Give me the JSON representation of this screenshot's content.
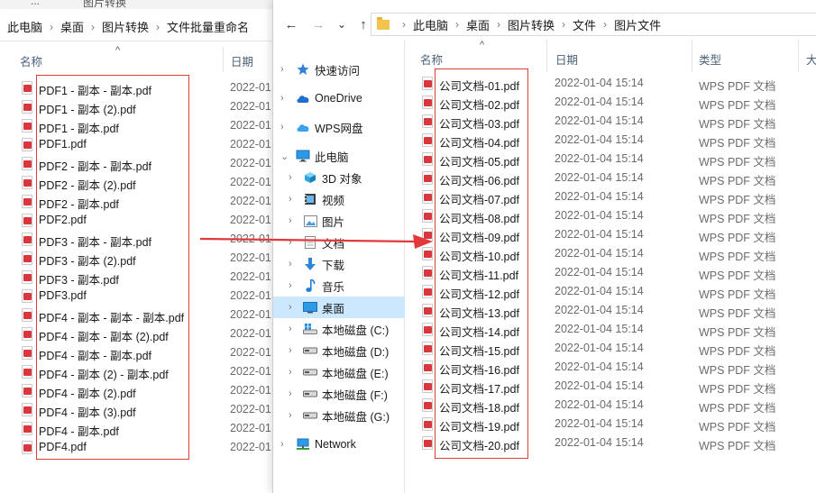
{
  "left_window": {
    "top_stubs": [
      "...",
      "图片转换"
    ],
    "breadcrumb": [
      "此电脑",
      "桌面",
      "图片转换",
      "文件批量重命名"
    ],
    "columns": {
      "name": "名称",
      "date": "日期"
    },
    "files": [
      {
        "name": "PDF1 - 副本 - 副本.pdf",
        "date": "2022-01"
      },
      {
        "name": "PDF1 - 副本 (2).pdf",
        "date": "2022-01"
      },
      {
        "name": "PDF1 - 副本.pdf",
        "date": "2022-01"
      },
      {
        "name": "PDF1.pdf",
        "date": "2022-01"
      },
      {
        "name": "PDF2 - 副本 - 副本.pdf",
        "date": "2022-01"
      },
      {
        "name": "PDF2 - 副本 (2).pdf",
        "date": "2022-01"
      },
      {
        "name": "PDF2 - 副本.pdf",
        "date": "2022-01"
      },
      {
        "name": "PDF2.pdf",
        "date": "2022-01"
      },
      {
        "name": "PDF3 - 副本 - 副本.pdf",
        "date": "2022-01"
      },
      {
        "name": "PDF3 - 副本 (2).pdf",
        "date": "2022-01"
      },
      {
        "name": "PDF3 - 副本.pdf",
        "date": "2022-01"
      },
      {
        "name": "PDF3.pdf",
        "date": "2022-01"
      },
      {
        "name": "PDF4 - 副本 - 副本 - 副本.pdf",
        "date": "2022-01"
      },
      {
        "name": "PDF4 - 副本 - 副本 (2).pdf",
        "date": "2022-01"
      },
      {
        "name": "PDF4 - 副本 - 副本.pdf",
        "date": "2022-01"
      },
      {
        "name": "PDF4 - 副本 (2) - 副本.pdf",
        "date": "2022-01"
      },
      {
        "name": "PDF4 - 副本 (2).pdf",
        "date": "2022-01"
      },
      {
        "name": "PDF4 - 副本 (3).pdf",
        "date": "2022-01"
      },
      {
        "name": "PDF4 - 副本.pdf",
        "date": "2022-01"
      },
      {
        "name": "PDF4.pdf",
        "date": "2022-01"
      }
    ]
  },
  "right_window": {
    "breadcrumb": [
      "此电脑",
      "桌面",
      "图片转换",
      "文件",
      "图片文件"
    ],
    "nav_icons": {
      "back": "←",
      "forward": "→",
      "recent": "⌄",
      "up": "↑"
    },
    "columns": {
      "name": "名称",
      "date": "日期",
      "type": "类型",
      "size": "大"
    },
    "nav_items": [
      {
        "label": "快速访问",
        "icon": "star-icon",
        "chev": "›"
      },
      {
        "label": "OneDrive",
        "icon": "cloud-icon",
        "chev": "›"
      },
      {
        "label": "WPS网盘",
        "icon": "cloud-icon",
        "chev": "›"
      },
      {
        "label": "此电脑",
        "icon": "computer-icon",
        "chev": "⌄"
      },
      {
        "label": "3D 对象",
        "icon": "cube-icon",
        "chev": "›"
      },
      {
        "label": "视频",
        "icon": "video-icon",
        "chev": "›"
      },
      {
        "label": "图片",
        "icon": "picture-icon",
        "chev": "›"
      },
      {
        "label": "文档",
        "icon": "document-icon",
        "chev": "›"
      },
      {
        "label": "下载",
        "icon": "download-icon",
        "chev": "›"
      },
      {
        "label": "音乐",
        "icon": "music-icon",
        "chev": "›"
      },
      {
        "label": "桌面",
        "icon": "desktop-icon",
        "chev": "›"
      },
      {
        "label": "本地磁盘 (C:)",
        "icon": "windows-drive-icon",
        "chev": "›"
      },
      {
        "label": "本地磁盘 (D:)",
        "icon": "drive-icon",
        "chev": "›"
      },
      {
        "label": "本地磁盘 (E:)",
        "icon": "drive-icon",
        "chev": "›"
      },
      {
        "label": "本地磁盘 (F:)",
        "icon": "drive-icon",
        "chev": "›"
      },
      {
        "label": "本地磁盘 (G:)",
        "icon": "drive-icon",
        "chev": "›"
      },
      {
        "label": "Network",
        "icon": "network-icon",
        "chev": "›"
      }
    ],
    "selected_nav": "桌面",
    "files": [
      {
        "name": "公司文档-01.pdf",
        "date": "2022-01-04 15:14",
        "type": "WPS PDF 文档"
      },
      {
        "name": "公司文档-02.pdf",
        "date": "2022-01-04 15:14",
        "type": "WPS PDF 文档"
      },
      {
        "name": "公司文档-03.pdf",
        "date": "2022-01-04 15:14",
        "type": "WPS PDF 文档"
      },
      {
        "name": "公司文档-04.pdf",
        "date": "2022-01-04 15:14",
        "type": "WPS PDF 文档"
      },
      {
        "name": "公司文档-05.pdf",
        "date": "2022-01-04 15:14",
        "type": "WPS PDF 文档"
      },
      {
        "name": "公司文档-06.pdf",
        "date": "2022-01-04 15:14",
        "type": "WPS PDF 文档"
      },
      {
        "name": "公司文档-07.pdf",
        "date": "2022-01-04 15:14",
        "type": "WPS PDF 文档"
      },
      {
        "name": "公司文档-08.pdf",
        "date": "2022-01-04 15:14",
        "type": "WPS PDF 文档"
      },
      {
        "name": "公司文档-09.pdf",
        "date": "2022-01-04 15:14",
        "type": "WPS PDF 文档"
      },
      {
        "name": "公司文档-10.pdf",
        "date": "2022-01-04 15:14",
        "type": "WPS PDF 文档"
      },
      {
        "name": "公司文档-11.pdf",
        "date": "2022-01-04 15:14",
        "type": "WPS PDF 文档"
      },
      {
        "name": "公司文档-12.pdf",
        "date": "2022-01-04 15:14",
        "type": "WPS PDF 文档"
      },
      {
        "name": "公司文档-13.pdf",
        "date": "2022-01-04 15:14",
        "type": "WPS PDF 文档"
      },
      {
        "name": "公司文档-14.pdf",
        "date": "2022-01-04 15:14",
        "type": "WPS PDF 文档"
      },
      {
        "name": "公司文档-15.pdf",
        "date": "2022-01-04 15:14",
        "type": "WPS PDF 文档"
      },
      {
        "name": "公司文档-16.pdf",
        "date": "2022-01-04 15:14",
        "type": "WPS PDF 文档"
      },
      {
        "name": "公司文档-17.pdf",
        "date": "2022-01-04 15:14",
        "type": "WPS PDF 文档"
      },
      {
        "name": "公司文档-18.pdf",
        "date": "2022-01-04 15:14",
        "type": "WPS PDF 文档"
      },
      {
        "name": "公司文档-19.pdf",
        "date": "2022-01-04 15:14",
        "type": "WPS PDF 文档"
      },
      {
        "name": "公司文档-20.pdf",
        "date": "2022-01-04 15:14",
        "type": "WPS PDF 文档"
      }
    ]
  },
  "colors": {
    "highlight_frame": "#e03a3a",
    "arrow": "#e03a3a",
    "selected_nav_bg": "#cce8ff",
    "pdf_icon_red": "#d9363e"
  }
}
